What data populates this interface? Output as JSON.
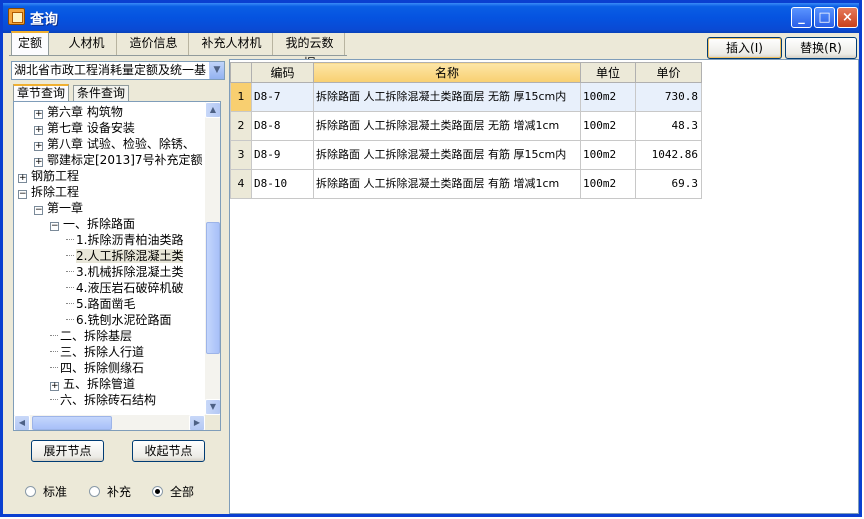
{
  "window": {
    "title": "查询",
    "min_glyph": "_",
    "max_glyph": "□",
    "close_glyph": "×"
  },
  "tabs": [
    {
      "label": "定额",
      "active": true
    },
    {
      "label": "人材机",
      "active": false
    },
    {
      "label": "造价信息",
      "active": false
    },
    {
      "label": "补充人材机",
      "active": false
    },
    {
      "label": "我的云数据",
      "active": false
    }
  ],
  "actions": {
    "insert_label": "插入(I)",
    "replace_label": "替换(R)"
  },
  "left": {
    "quota_library": "湖北省市政工程消耗量定额及统一基",
    "subtabs": [
      {
        "label": "章节查询",
        "active": true
      },
      {
        "label": "条件查询",
        "active": false
      }
    ],
    "tree": [
      {
        "label": "第六章 构筑物",
        "level": 2,
        "exp": "+"
      },
      {
        "label": "第七章 设备安装",
        "level": 2,
        "exp": "+"
      },
      {
        "label": "第八章 试验、检验、除锈、",
        "level": 2,
        "exp": "+"
      },
      {
        "label": "鄂建标定[2013]7号补充定额",
        "level": 2,
        "exp": "+"
      },
      {
        "label": "钢筋工程",
        "level": 1,
        "exp": "+"
      },
      {
        "label": "拆除工程",
        "level": 1,
        "exp": "-"
      },
      {
        "label": "第一章",
        "level": 2,
        "exp": "-"
      },
      {
        "label": "一、拆除路面",
        "level": 3,
        "exp": "-"
      },
      {
        "label": "1.拆除沥青柏油类路",
        "level": 4,
        "exp": ""
      },
      {
        "label": "2.人工拆除混凝土类",
        "level": 4,
        "exp": "",
        "selected": true
      },
      {
        "label": "3.机械拆除混凝土类",
        "level": 4,
        "exp": ""
      },
      {
        "label": "4.液压岩石破碎机破",
        "level": 4,
        "exp": ""
      },
      {
        "label": "5.路面凿毛",
        "level": 4,
        "exp": ""
      },
      {
        "label": "6.铣刨水泥砼路面",
        "level": 4,
        "exp": ""
      },
      {
        "label": "二、拆除基层",
        "level": 3,
        "exp": ""
      },
      {
        "label": "三、拆除人行道",
        "level": 3,
        "exp": ""
      },
      {
        "label": "四、拆除侧缘石",
        "level": 3,
        "exp": ""
      },
      {
        "label": "五、拆除管道",
        "level": 3,
        "exp": "+"
      },
      {
        "label": "六、拆除砖石结构",
        "level": 3,
        "exp": ""
      }
    ],
    "expand_label": "展开节点",
    "collapse_label": "收起节点",
    "radios": [
      {
        "label": "标准",
        "checked": false
      },
      {
        "label": "补充",
        "checked": false
      },
      {
        "label": "全部",
        "checked": true
      }
    ]
  },
  "grid": {
    "columns": [
      "编码",
      "名称",
      "单位",
      "单价"
    ],
    "rows": [
      {
        "idx": "1",
        "code": "D8-7",
        "name": "拆除路面 人工拆除混凝土类路面层 无筋 厚15cm内",
        "unit": "100m2",
        "price": "730.8",
        "selected": true
      },
      {
        "idx": "2",
        "code": "D8-8",
        "name": "拆除路面 人工拆除混凝土类路面层 无筋 增减1cm",
        "unit": "100m2",
        "price": "48.3"
      },
      {
        "idx": "3",
        "code": "D8-9",
        "name": "拆除路面 人工拆除混凝土类路面层 有筋 厚15cm内",
        "unit": "100m2",
        "price": "1042.86"
      },
      {
        "idx": "4",
        "code": "D8-10",
        "name": "拆除路面 人工拆除混凝土类路面层 有筋 增减1cm",
        "unit": "100m2",
        "price": "69.3"
      }
    ]
  },
  "colors": {
    "title_bar": "#0553e0",
    "header_highlight": "#f8cf70",
    "window_bg": "#ece9d8"
  }
}
